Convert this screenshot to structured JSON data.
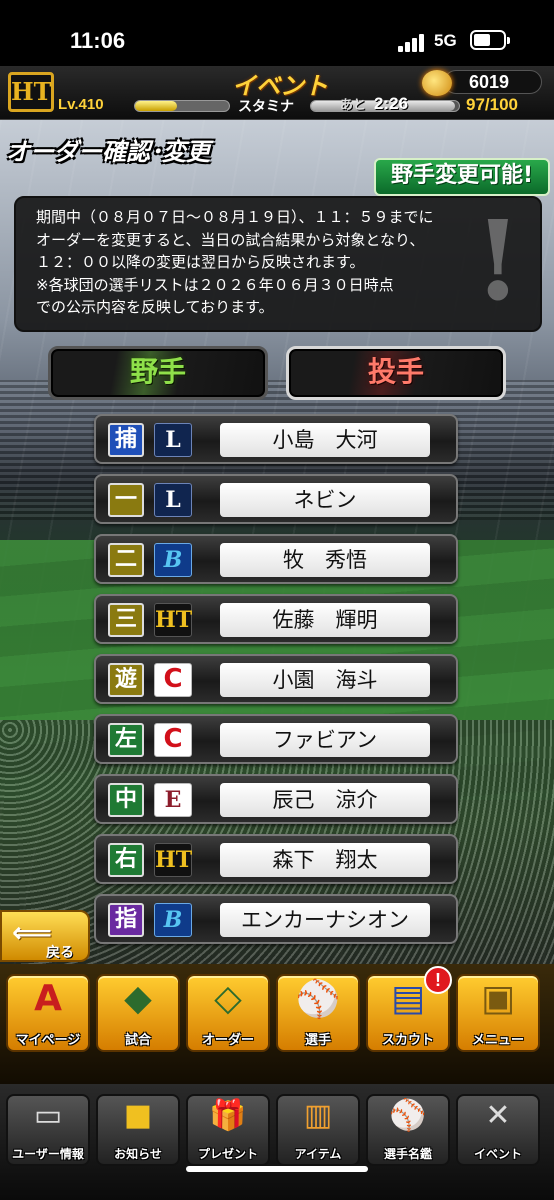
{
  "status_bar": {
    "time": "11:06",
    "network": "5G"
  },
  "header": {
    "team_logo": "tigers-logo",
    "title": "イベント",
    "coins": "6019",
    "level_label": "Lv.410",
    "stamina_label": "スタミナ",
    "stamina_timer_prefix": "あと",
    "stamina_timer": "2:26",
    "stamina_value": "97/100"
  },
  "page": {
    "title": "オーダー確認･変更",
    "badge": "野手変更可能!",
    "notice_lines": [
      "期間中（０８月０７日〜０８月１９日）、１１：５９までに",
      "オーダーを変更すると、当日の試合結果から対象となり、",
      "１２：００以降の変更は翌日から反映されます。",
      "※各球団の選手リストは２０２６年０６月３０日時点",
      "での公示内容を反映しております。"
    ]
  },
  "tabs": {
    "fielder": "野手",
    "pitcher": "投手"
  },
  "lineup": [
    {
      "position": "捕",
      "pos_color": "#1f4fb8",
      "team_icon": "lions-logo",
      "team_glyph": "L",
      "name": "小島　大河"
    },
    {
      "position": "一",
      "pos_color": "#8a7a10",
      "team_icon": "lions-logo",
      "team_glyph": "L",
      "name": "ネビン"
    },
    {
      "position": "二",
      "pos_color": "#8a7a10",
      "team_icon": "baystars-logo",
      "team_glyph": "B",
      "name": "牧　秀悟"
    },
    {
      "position": "三",
      "pos_color": "#8a7a10",
      "team_icon": "tigers-logo",
      "team_glyph": "HT",
      "name": "佐藤　輝明"
    },
    {
      "position": "遊",
      "pos_color": "#8a7a10",
      "team_icon": "carp-logo",
      "team_glyph": "C",
      "name": "小園　海斗"
    },
    {
      "position": "左",
      "pos_color": "#1f7a34",
      "team_icon": "carp-logo",
      "team_glyph": "C",
      "name": "ファビアン"
    },
    {
      "position": "中",
      "pos_color": "#1f7a34",
      "team_icon": "eagles-logo",
      "team_glyph": "E",
      "name": "辰己　涼介"
    },
    {
      "position": "右",
      "pos_color": "#1f7a34",
      "team_icon": "tigers-logo",
      "team_glyph": "HT",
      "name": "森下　翔太"
    },
    {
      "position": "指",
      "pos_color": "#6a2aa0",
      "team_icon": "baystars-logo",
      "team_glyph": "B",
      "name": "エンカーナシオン"
    }
  ],
  "back_button": "戻る",
  "nav_main": [
    {
      "label": "マイページ",
      "icon": "A",
      "icon_name": "mypage-icon"
    },
    {
      "label": "試合",
      "icon": "◆",
      "icon_name": "stadium-icon"
    },
    {
      "label": "オーダー",
      "icon": "◇",
      "icon_name": "order-icon"
    },
    {
      "label": "選手",
      "icon": "⚾",
      "icon_name": "player-icon"
    },
    {
      "label": "スカウト",
      "icon": "▤",
      "icon_name": "scout-icon",
      "badge": "!"
    },
    {
      "label": "メニュー",
      "icon": "▣",
      "icon_name": "menu-icon"
    }
  ],
  "nav_sub": [
    {
      "label": "ユーザー情報",
      "icon": "▭",
      "icon_name": "user-info-icon"
    },
    {
      "label": "お知らせ",
      "icon": "■",
      "icon_name": "news-icon"
    },
    {
      "label": "プレゼント",
      "icon": "🎁",
      "icon_name": "present-icon"
    },
    {
      "label": "アイテム",
      "icon": "▥",
      "icon_name": "item-icon"
    },
    {
      "label": "選手名鑑",
      "icon": "⚾",
      "icon_name": "player-directory-icon"
    },
    {
      "label": "イベント",
      "icon": "✕",
      "icon_name": "event-icon"
    }
  ],
  "colors": {
    "accent": "#ffd23a",
    "fielder_tab": "#8fe04a",
    "pitcher_tab": "#ff7a6a",
    "badge": "#1f8f40"
  }
}
